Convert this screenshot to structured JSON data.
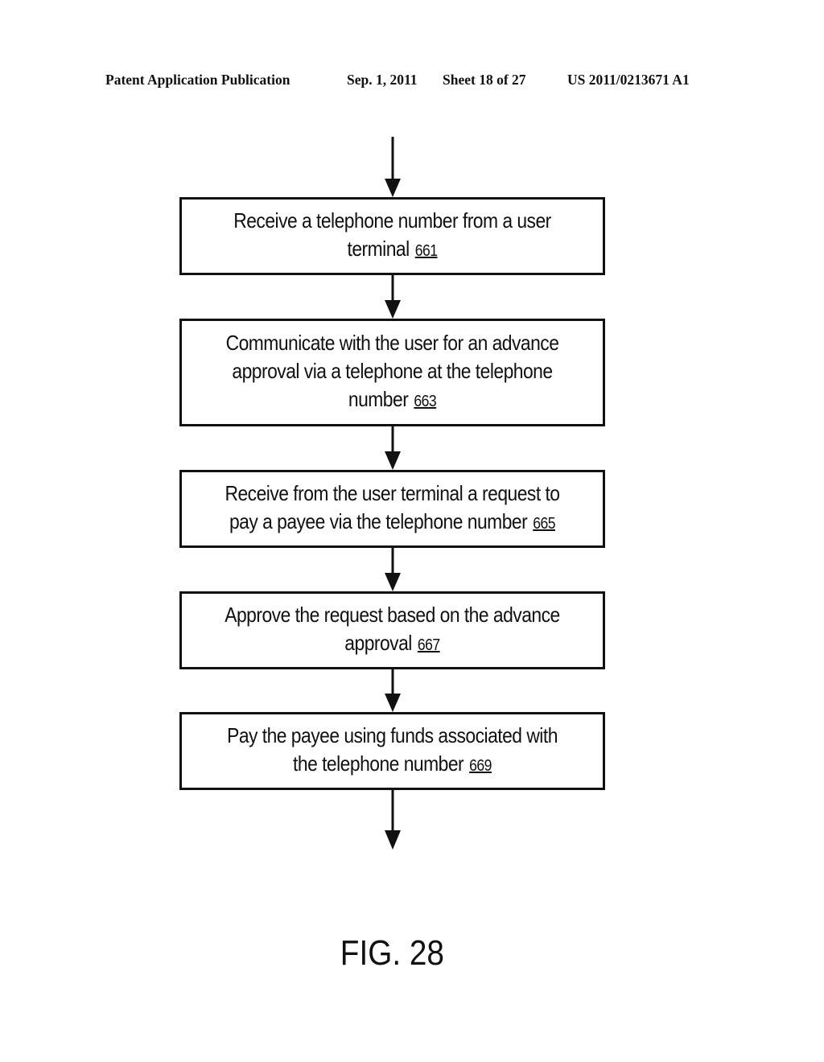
{
  "header": {
    "publication_type": "Patent Application Publication",
    "date": "Sep. 1, 2011",
    "sheet": "Sheet 18 of 27",
    "publication_number": "US 2011/0213671 A1"
  },
  "flowchart": {
    "steps": [
      {
        "text": "Receive a telephone number from a user terminal",
        "ref": "661"
      },
      {
        "text": "Communicate with the user for an advance approval via a telephone at the telephone number",
        "ref": "663"
      },
      {
        "text": "Receive from the user terminal a request to pay a payee via the telephone number",
        "ref": "665"
      },
      {
        "text": "Approve the request based on the advance approval",
        "ref": "667"
      },
      {
        "text": "Pay the payee using funds associated with the telephone number",
        "ref": "669"
      }
    ],
    "icons": {
      "entry_arrow": "arrow-down-icon",
      "connector_arrow": "arrow-down-icon",
      "exit_arrow": "arrow-down-icon"
    }
  },
  "figure_label": "FIG. 28"
}
